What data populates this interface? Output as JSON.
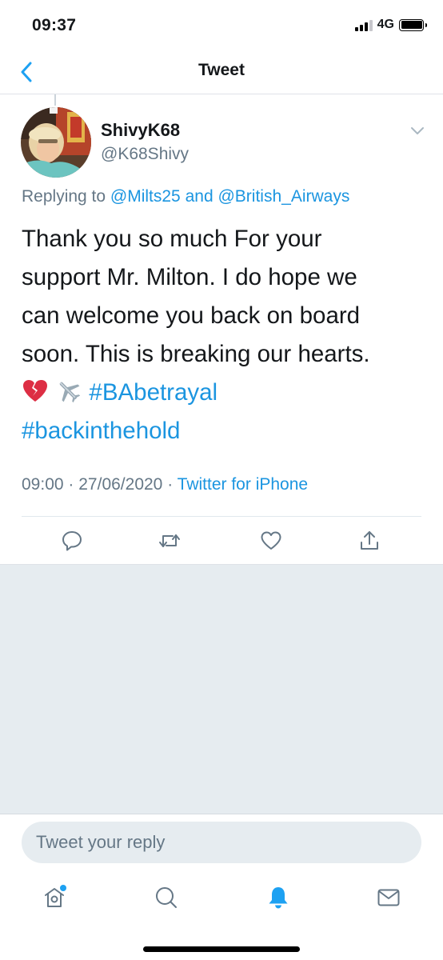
{
  "status_bar": {
    "time": "09:37",
    "network": "4G",
    "battery_level": 1.0
  },
  "nav": {
    "title": "Tweet",
    "back_icon": "chevron-left-icon"
  },
  "tweet": {
    "display_name": "ShivyK68",
    "handle": "@K68Shivy",
    "replying_prefix": "Replying to",
    "reply_to_1": "@Milts25",
    "reply_and": "and",
    "reply_to_2": "@British_Airways",
    "lines": [
      "Thank you so much For your",
      "support Mr. Milton. I do hope we",
      "can welcome you back on board",
      "soon. This is breaking our hearts."
    ],
    "emojis": [
      "broken-heart",
      "airplane"
    ],
    "hashtag_1": "#BAbetrayal",
    "hashtag_2": "#backinthehold",
    "time": "09:00",
    "dot": "·",
    "date": "27/06/2020",
    "source": "Twitter for iPhone"
  },
  "actions": {
    "reply_icon": "reply-icon",
    "retweet_icon": "retweet-icon",
    "like_icon": "heart-icon",
    "share_icon": "share-icon"
  },
  "reply_box": {
    "placeholder": "Tweet your reply"
  },
  "tabbar": {
    "items": [
      "home-icon",
      "search-icon",
      "notifications-icon",
      "messages-icon"
    ],
    "active": "notifications-icon"
  },
  "colors": {
    "accent": "#1b95e0",
    "muted": "#657786",
    "background_gray": "#e6ecf0"
  }
}
